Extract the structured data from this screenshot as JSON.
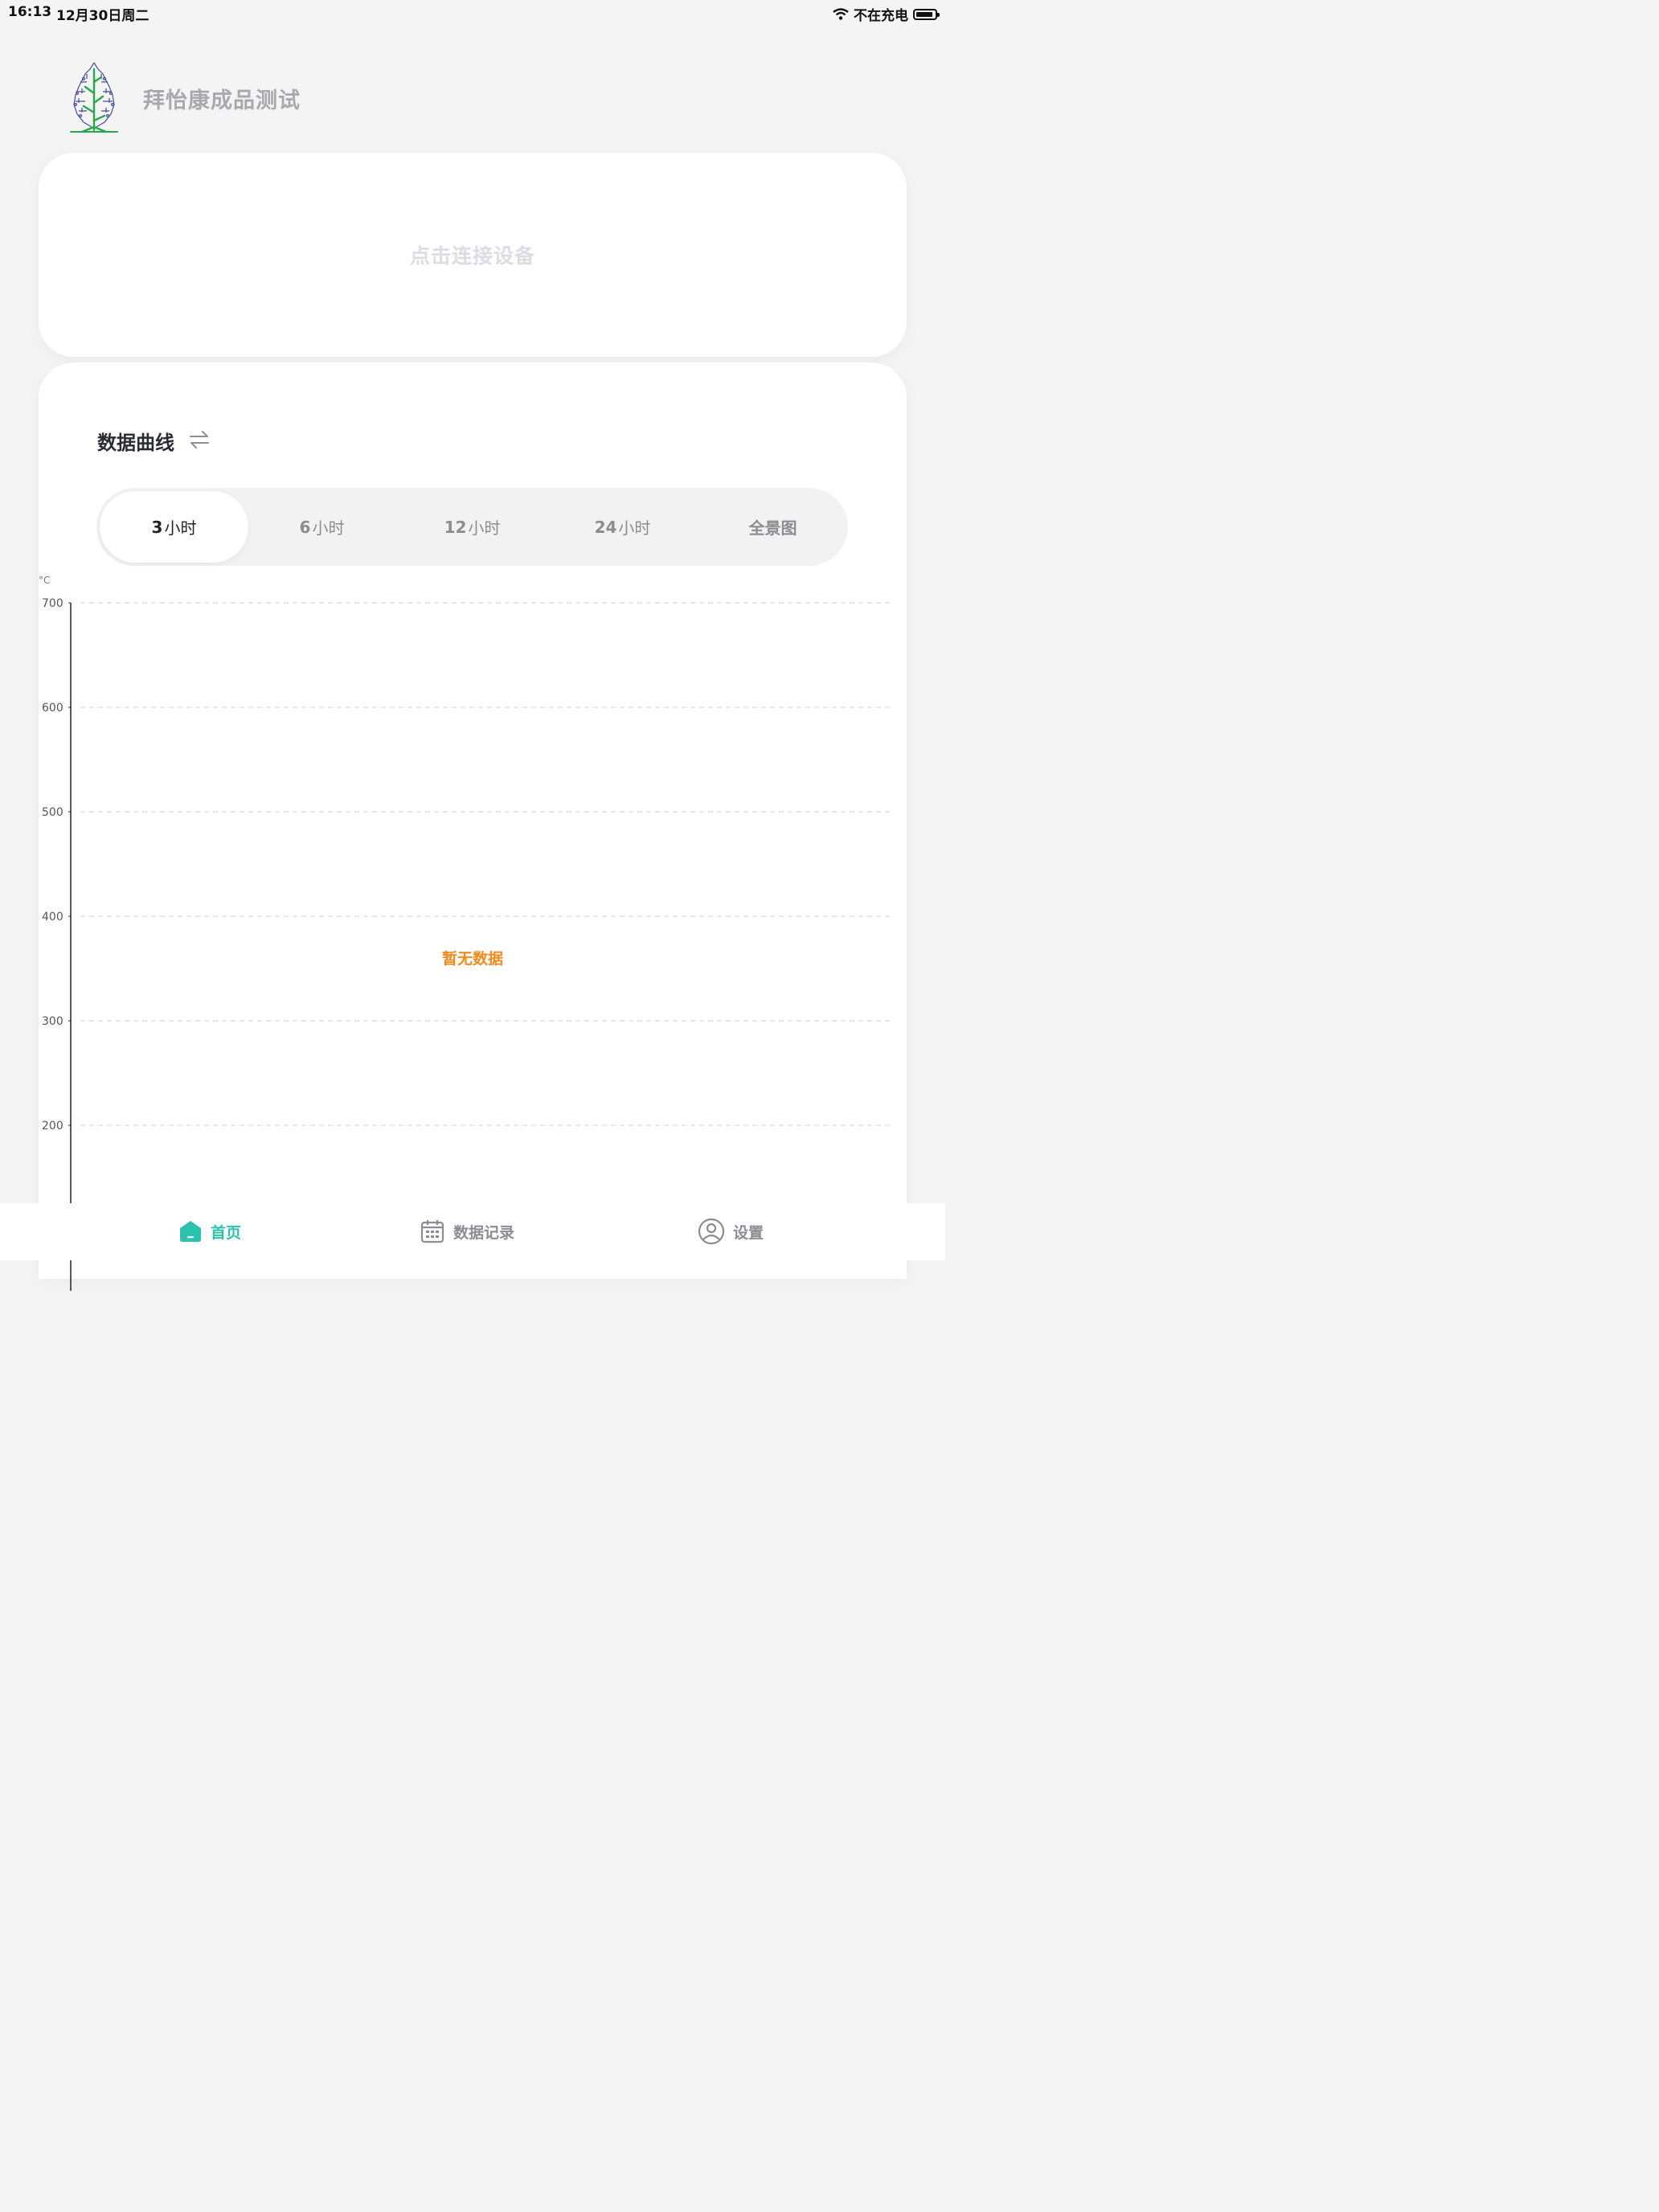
{
  "status_bar": {
    "time": "16:13",
    "date": "12月30日周二",
    "charging": "不在充电"
  },
  "header": {
    "title": "拜怡康成品测试"
  },
  "connect": {
    "label": "点击连接设备"
  },
  "chart_section": {
    "title": "数据曲线",
    "ranges": [
      {
        "num": "3",
        "unit": "小时",
        "active": true
      },
      {
        "num": "6",
        "unit": "小时",
        "active": false
      },
      {
        "num": "12",
        "unit": "小时",
        "active": false
      },
      {
        "num": "24",
        "unit": "小时",
        "active": false
      },
      {
        "num": "",
        "unit": "全景图",
        "active": false
      }
    ]
  },
  "chart_data": {
    "type": "line",
    "unit_label": "°C",
    "y_ticks": [
      700,
      600,
      500,
      400,
      300,
      200
    ],
    "ylim": [
      200,
      700
    ],
    "series": [],
    "grid": "dashed horizontal",
    "empty_text": "暂无数据"
  },
  "tabbar": {
    "items": [
      {
        "label": "首页",
        "icon": "home-icon",
        "active": true
      },
      {
        "label": "数据记录",
        "icon": "calendar-icon",
        "active": false
      },
      {
        "label": "设置",
        "icon": "user-icon",
        "active": false
      }
    ]
  },
  "colors": {
    "accent": "#2bc2ad",
    "empty_text": "#f28a1c",
    "inactive": "#8c8c92"
  }
}
